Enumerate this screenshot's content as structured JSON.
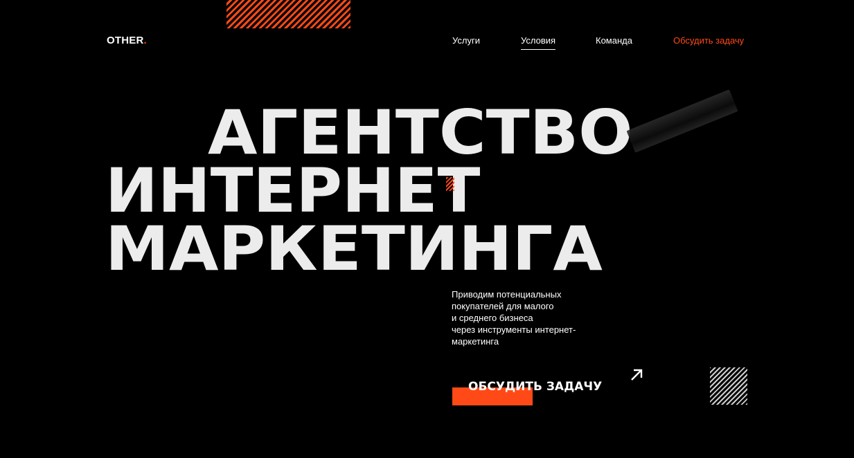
{
  "brand": {
    "name": "OTHER",
    "dot": ".",
    "accent_color": "#ff4a17"
  },
  "nav": {
    "items": [
      {
        "label": "Услуги"
      },
      {
        "label": "Условия"
      },
      {
        "label": "Команда"
      }
    ],
    "active_label": "Условия",
    "cta_label": "Обсудить задачу"
  },
  "hero": {
    "headline": [
      "АГЕНТСТВО",
      "ИНТЕРНЕТ",
      "МАРКЕТИНГА"
    ],
    "description": [
      "Приводим потенциальных",
      "покупателей для малого",
      "и среднего бизнеса",
      "через инструменты интернет-",
      "маркетинга"
    ],
    "cta_label": "ОБСУДИТЬ ЗАДАЧУ",
    "cta_icon": "arrow-up-right-icon"
  }
}
